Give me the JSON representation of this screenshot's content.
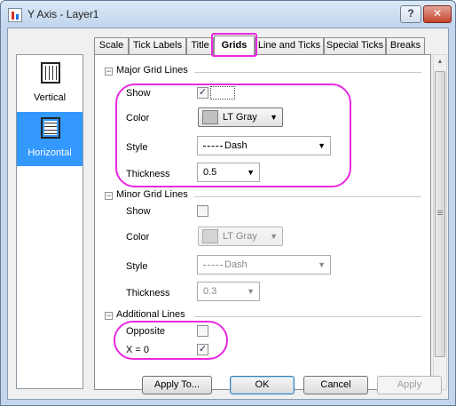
{
  "window": {
    "title": "Y Axis - Layer1",
    "help_label": "?",
    "close_label": "✕"
  },
  "side": {
    "items": [
      {
        "label": "Vertical",
        "selected": false
      },
      {
        "label": "Horizontal",
        "selected": true
      }
    ]
  },
  "tabs": [
    "Scale",
    "Tick Labels",
    "Title",
    "Grids",
    "Line and Ticks",
    "Special Ticks",
    "Breaks"
  ],
  "active_tab": "Grids",
  "major": {
    "title": "Major Grid Lines",
    "show_label": "Show",
    "show_checked": true,
    "color_label": "Color",
    "color_value": "LT Gray",
    "style_label": "Style",
    "style_value": "Dash",
    "thickness_label": "Thickness",
    "thickness_value": "0.5"
  },
  "minor": {
    "title": "Minor Grid Lines",
    "show_label": "Show",
    "show_checked": false,
    "color_label": "Color",
    "color_value": "LT Gray",
    "style_label": "Style",
    "style_value": "Dash",
    "thickness_label": "Thickness",
    "thickness_value": "0.3"
  },
  "additional": {
    "title": "Additional Lines",
    "opposite_label": "Opposite",
    "opposite_checked": false,
    "x0_label": "X = 0",
    "x0_checked": true
  },
  "buttons": {
    "apply_to": "Apply To...",
    "ok": "OK",
    "cancel": "Cancel",
    "apply": "Apply"
  },
  "glyphs": {
    "check": "✓",
    "collapse": "−",
    "dropdown": "▼",
    "scroll_up": "▲",
    "scroll_down": "▼"
  },
  "colors": {
    "highlight": "#ea28e2",
    "selection": "#3399ff",
    "lt_gray": "#c0c0c0"
  }
}
